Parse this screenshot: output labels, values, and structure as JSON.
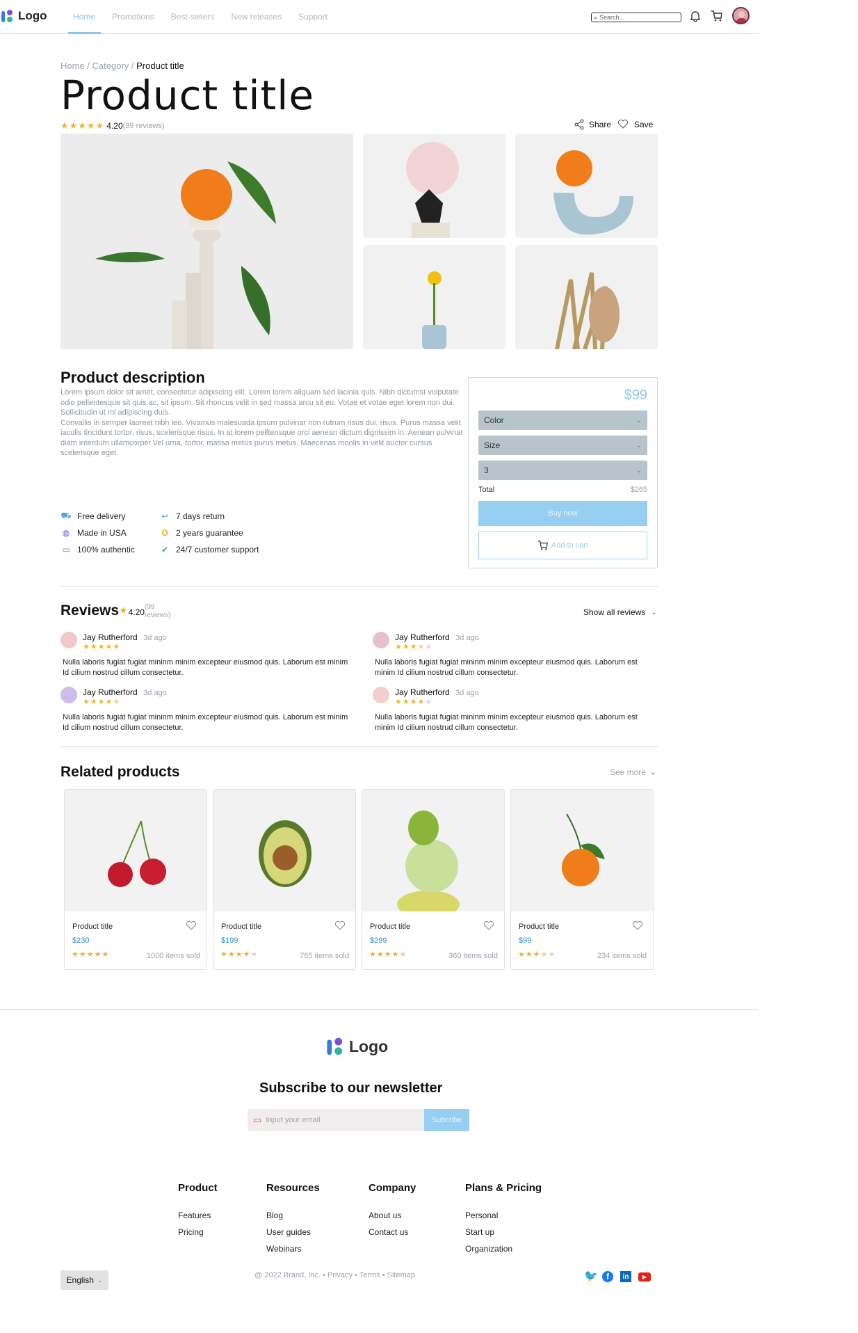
{
  "header": {
    "logo": "Logo",
    "nav": [
      "Home",
      "Promotions",
      "Best-sellers",
      "New releases",
      "Support"
    ],
    "search_placeholder": "Search..."
  },
  "breadcrumb": {
    "home": "Home",
    "sep": " / ",
    "category": "Category",
    "current": "Product title"
  },
  "product": {
    "title": "Product title",
    "rating": "4.20",
    "reviews": "(99 reviews)",
    "share": "Share",
    "save": "Save",
    "description_title": "Product description",
    "description": "Lorem ipsum dolor sit amet, consectetur adipiscing elit. Lorem lorem aliquam sed lacinia quis. Nibh dictumst vulputate\nodio pellentesque sit quis ac, sit ipsum. Sit rhoncus velit in sed massa arcu sit eu. Votae et votae eget lorem non dui.\nSollicitudin ut mi adipiscing duis.\nConvallis in semper laoreet nibh leo. Vivamus malesuada ipsum pulvinar non rutrum risus dui, risus. Purus massa velit\niaculis tincidunt tortor, risus, scelerisque risus. In at lorem pelltensque orci aenean dictum dignissim in. Aenean pulvinar diam interdum ullamcorper.Vel urna, tortor, massa metus purus metus. Maecenas moolis in velit auctor cursus\nscelerisque eget.",
    "features": [
      "Free delivery",
      "7 days return",
      "Made in USA",
      "2 years guarantee",
      "100% authentic",
      "24/7 customer support"
    ]
  },
  "buybox": {
    "price": "$99",
    "color": "Color",
    "size": "Size",
    "qty": "3",
    "total_label": "Total",
    "total": "$265",
    "buy": "Buy now",
    "cart": "Add to cart"
  },
  "reviews": {
    "title": "Reviews",
    "rating": "4.20",
    "count_line1": "(99",
    "count_line2": "reviews)",
    "show_all": "Show all reviews",
    "items": [
      {
        "name": "Jay Rutherford",
        "ago": "3d ago",
        "stars": 5,
        "text": "Nulla laboris fugiat fugiat mininm minim excepteur eiusmod quis. Laborum est minim Id cilium nostrud cillum consectetur."
      },
      {
        "name": "Jay Rutherford",
        "ago": "3d ago",
        "stars": 3.5,
        "text": "Nulla laboris fugiat fugiat mininm minim excepteur eiusmod quis. Laborum est minim Id cilium nostrud cillum consectetur."
      },
      {
        "name": "Jay Rutherford",
        "ago": "3d ago",
        "stars": 4.5,
        "text": "Nulla laboris fugiat fugiat mininm minim excepteur eiusmod quis. Laborum est minim Id cilium nostrud cillum consectetur."
      },
      {
        "name": "Jay Rutherford",
        "ago": "3d ago",
        "stars": 4,
        "text": "Nulla laboris fugiat fugiat mininm minim excepteur eiusmod quis. Laborum est minim Id cilium nostrud cillum consectetur."
      }
    ]
  },
  "related": {
    "title": "Related products",
    "see_more": "See more",
    "items": [
      {
        "title": "Product title",
        "price": "$230",
        "sold": "1000 items sold",
        "stars": 5
      },
      {
        "title": "Product title",
        "price": "$199",
        "sold": "765 items sold",
        "stars": 4
      },
      {
        "title": "Product title",
        "price": "$299",
        "sold": "360 items sold",
        "stars": 4.5
      },
      {
        "title": "Product title",
        "price": "$99",
        "sold": "234 items sold",
        "stars": 3.5
      }
    ]
  },
  "footer": {
    "logo": "Logo",
    "newsletter_title": "Subscribe to our newsletter",
    "email_placeholder": "Input your email",
    "subscribe": "Subcribe",
    "columns": [
      {
        "title": "Product",
        "links": [
          "Features",
          "Pricing"
        ]
      },
      {
        "title": "Resources",
        "links": [
          "Blog",
          "User guides",
          "Webinars"
        ]
      },
      {
        "title": "Company",
        "links": [
          "About us",
          "Contact us"
        ]
      },
      {
        "title": "Plans & Pricing",
        "links": [
          "Personal",
          "Start up",
          "Organization"
        ]
      }
    ],
    "language": "English",
    "copyright": "@ 2022 Brand, Inc. • Privacy • Terms • Sitemap"
  },
  "colors": {
    "accent": "#8ec5e8",
    "star": "#f0b429",
    "select_bg": "#b8c4cc"
  }
}
